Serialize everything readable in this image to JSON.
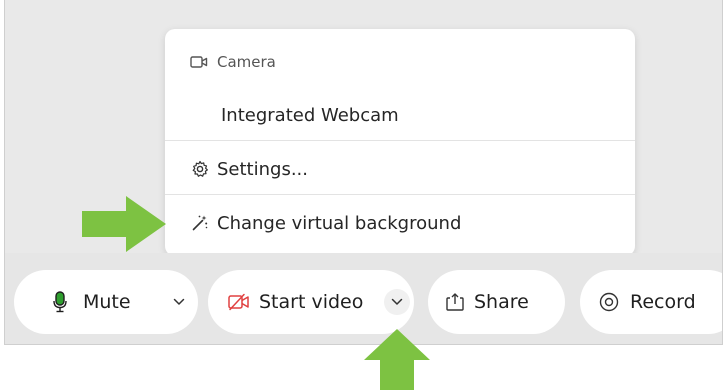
{
  "menu": {
    "section_header": "Camera",
    "camera_option": "Integrated Webcam",
    "settings_label": "Settings...",
    "virtual_background_label": "Change virtual background"
  },
  "toolbar": {
    "mute_label": "Mute",
    "start_video_label": "Start video",
    "share_label": "Share",
    "record_label": "Record"
  },
  "colors": {
    "mic_green": "#2e9e2e",
    "video_red": "#e04040",
    "annotation_arrow": "#7dc242",
    "toolbar_bg": "#e6e6e6",
    "meeting_bg": "#e9e9e9"
  },
  "icons": {
    "camera": "camera-icon",
    "settings": "gear-icon",
    "virtual_background": "magic-wand-icon",
    "mute": "microphone-icon",
    "video": "video-off-icon",
    "share": "share-icon",
    "record": "record-icon",
    "dropdown": "chevron-down-icon"
  }
}
